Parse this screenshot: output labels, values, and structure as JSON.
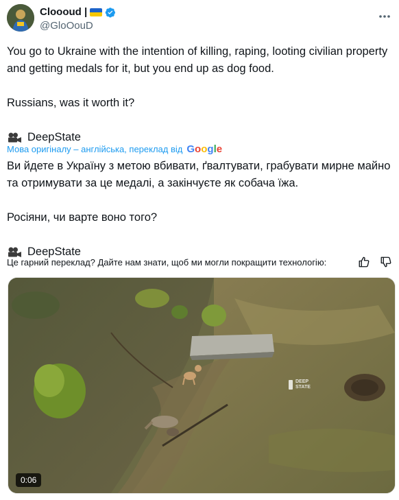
{
  "author": {
    "display_name": "Cloooud |",
    "handle": "@GloOouD",
    "verified": true
  },
  "tweet": {
    "paragraphs": [
      "You go to Ukraine with the intention of killing, raping, looting civilian property and getting medals for it, but you end up as dog food.",
      "Russians, was it worth it?"
    ],
    "source_label": "DeepState",
    "source_icon": "video-camera-icon"
  },
  "translation": {
    "notice": "Мова оригіналу – англійська, переклад від",
    "provider": "Google",
    "paragraphs": [
      "Ви йдете в Україну з метою вбивати, ґвалтувати, грабувати мирне майно та отримувати за це медалі, а закінчуєте як собача їжа.",
      "Росіяни, чи варте воно того?"
    ],
    "source_label": "DeepState"
  },
  "feedback": {
    "prompt": "Це гарний переклад? Дайте нам знати, щоб ми могли покращити технологію:"
  },
  "media": {
    "duration": "0:06",
    "watermark_line1": "DEEP",
    "watermark_line2": "STATE"
  },
  "colors": {
    "link": "#1d9bf0",
    "text": "#0f1419",
    "secondary": "#536471",
    "verified": "#1d9bf0"
  }
}
